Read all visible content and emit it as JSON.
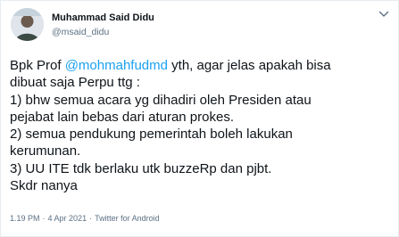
{
  "author": {
    "display_name": "Muhammad Said Didu",
    "handle": "@msaid_didu"
  },
  "tweet": {
    "line1_prefix": "Bpk Prof ",
    "line1_mention": "@mohmahfudmd",
    "line1_suffix": " yth, agar jelas apakah bisa",
    "line2": "dibuat saja Perpu ttg :",
    "line3": "1) bhw semua acara yg dihadiri oleh Presiden atau",
    "line4": "pejabat lain bebas dari aturan prokes.",
    "line5": "2) semua pendukung pemerintah boleh lakukan",
    "line6": "kerumunan.",
    "line7": "3) UU ITE tdk berlaku utk buzzeRp dan pjbt.",
    "line8": "Skdr nanya"
  },
  "meta": {
    "time": "1.19 PM",
    "separator": "·",
    "date": "4 Apr 2021",
    "client": "Twitter for Android"
  },
  "icons": {
    "menu": "more-options-icon",
    "avatar": "profile-photo"
  },
  "colors": {
    "mention": "#1da1f2",
    "secondary_text": "#5b7083",
    "primary_text": "#0f1419"
  }
}
